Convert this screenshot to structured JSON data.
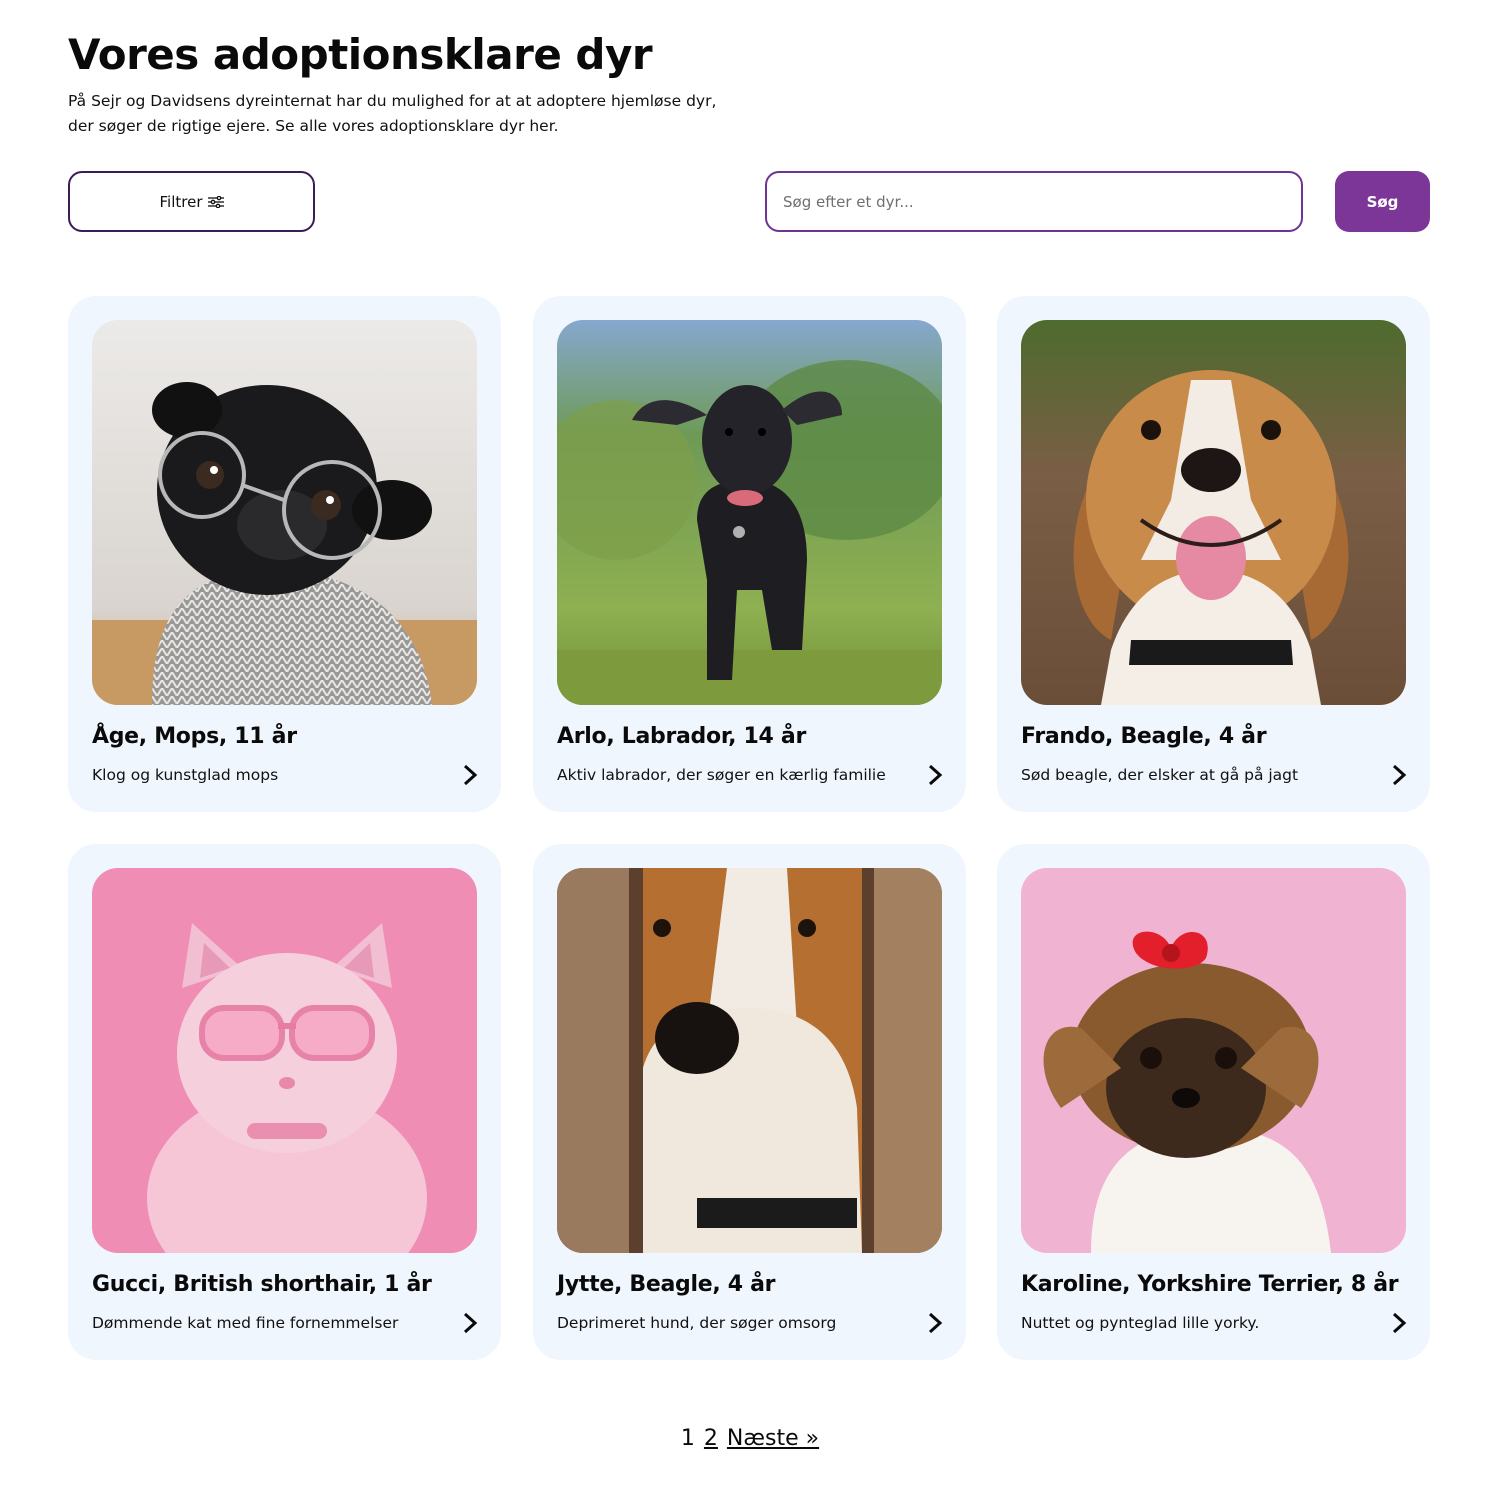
{
  "header": {
    "title": "Vores adoptionsklare dyr",
    "intro": "På Sejr og Davidsens dyreinternat har du mulighed for at at adoptere hjemløse dyr, der søger de rigtige ejere. Se alle vores adoptionsklare dyr her."
  },
  "toolbar": {
    "filter_label": "Filtrer",
    "filter_icon": "sliders-icon",
    "search_placeholder": "Søg efter et dyr...",
    "search_value": "",
    "search_button_label": "Søg"
  },
  "colors": {
    "accent": "#7b3698",
    "card_background": "#f0f6fd",
    "input_border": "#6c3493"
  },
  "animals": [
    {
      "title": "Åge, Mops, 11 år",
      "description": "Klog og kunstglad mops",
      "photo": "black pug with round glasses and knitted scarf"
    },
    {
      "title": "Arlo, Labrador, 14 år",
      "description": "Aktiv labrador, der søger en kærlig familie",
      "photo": "black labrador puppy running on grass"
    },
    {
      "title": "Frando, Beagle, 4 år",
      "description": "Sød beagle, der elsker at gå på jagt",
      "photo": "happy beagle with tongue out"
    },
    {
      "title": "Gucci, British shorthair, 1 år",
      "description": "Dømmende kat med fine fornemmelser",
      "photo": "pink cat with pink glasses on pink background"
    },
    {
      "title": "Jytte, Beagle, 4 år",
      "description": "Deprimeret hund, der søger omsorg",
      "photo": "beagle peeking between wooden boards"
    },
    {
      "title": "Karoline, Yorkshire Terrier, 8 år",
      "description": "Nuttet og pynteglad lille yorky.",
      "photo": "yorkshire terrier with red bow on pink background"
    }
  ],
  "pagination": {
    "current_page": "1",
    "page_2": "2",
    "next_label": "Næste »"
  }
}
